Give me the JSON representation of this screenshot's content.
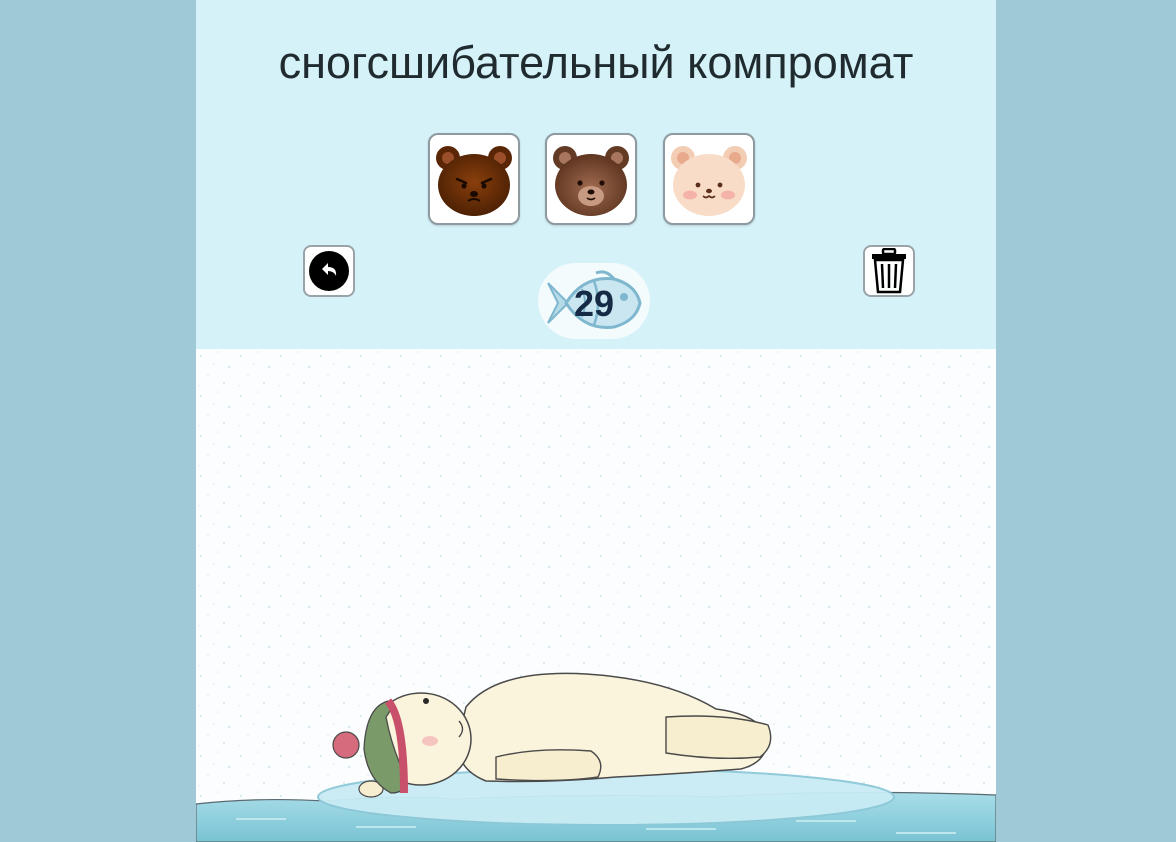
{
  "game": {
    "title": "сногсшибательный компромат",
    "fish_count": "29",
    "bears": [
      {
        "name": "angry-brown-bear",
        "color": "#6e3208"
      },
      {
        "name": "brown-bear",
        "color": "#7b4a2e"
      },
      {
        "name": "cream-bear",
        "color": "#f6d8c2"
      }
    ],
    "tools": {
      "undo_icon": "undo-arrow",
      "trash_icon": "trash-can"
    },
    "colors": {
      "page_background": "#a0c9d7",
      "header_background": "#d5f2f9",
      "counter_text": "#152a44",
      "water": "#8fd0de"
    }
  }
}
